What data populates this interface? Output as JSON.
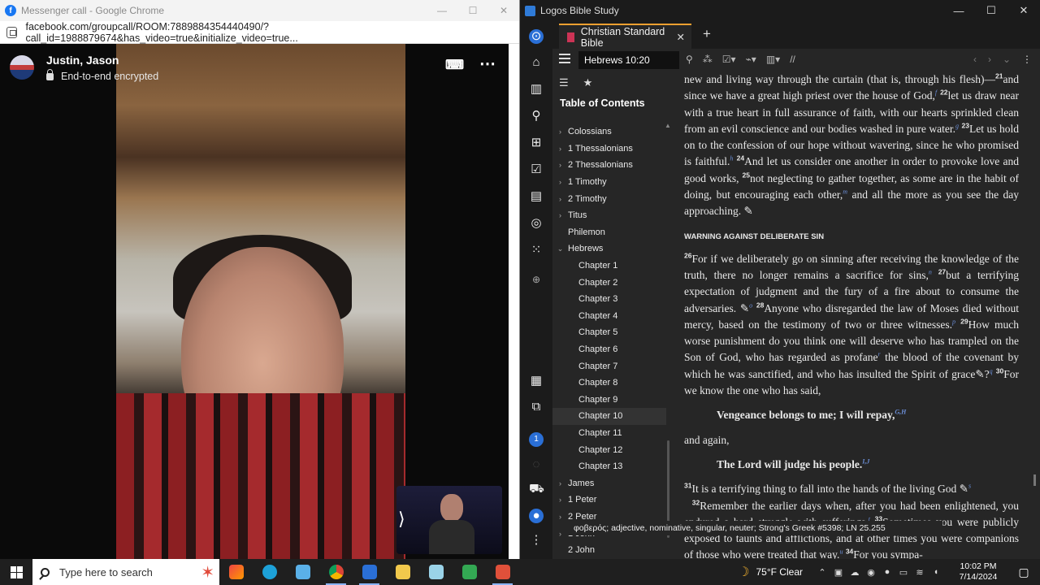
{
  "chrome": {
    "title": "Messenger call - Google Chrome",
    "url": "facebook.com/groupcall/ROOM:7889884354440490/?call_id=1988879674&has_video=true&initialize_video=true...",
    "minimize": "—",
    "maximize": "☐",
    "close": "✕"
  },
  "call": {
    "participant": "Justin, Jason",
    "encryption": "End-to-end encrypted",
    "more": "⋯"
  },
  "logos": {
    "title": "Logos Bible Study",
    "tab": "Christian Standard Bible",
    "reference": "Hebrews 10:20",
    "toc_title": "Table of Contents",
    "toc": [
      {
        "label": "Colossians",
        "type": "book",
        "arrow": "›"
      },
      {
        "label": "1 Thessalonians",
        "type": "book",
        "arrow": "›"
      },
      {
        "label": "2 Thessalonians",
        "type": "book",
        "arrow": "›"
      },
      {
        "label": "1 Timothy",
        "type": "book",
        "arrow": "›"
      },
      {
        "label": "2 Timothy",
        "type": "book",
        "arrow": "›"
      },
      {
        "label": "Titus",
        "type": "book",
        "arrow": "›"
      },
      {
        "label": "Philemon",
        "type": "book",
        "arrow": ""
      },
      {
        "label": "Hebrews",
        "type": "book",
        "arrow": "⌄"
      },
      {
        "label": "Chapter 1",
        "type": "chapter"
      },
      {
        "label": "Chapter 2",
        "type": "chapter"
      },
      {
        "label": "Chapter 3",
        "type": "chapter"
      },
      {
        "label": "Chapter 4",
        "type": "chapter"
      },
      {
        "label": "Chapter 5",
        "type": "chapter"
      },
      {
        "label": "Chapter 6",
        "type": "chapter"
      },
      {
        "label": "Chapter 7",
        "type": "chapter"
      },
      {
        "label": "Chapter 8",
        "type": "chapter"
      },
      {
        "label": "Chapter 9",
        "type": "chapter"
      },
      {
        "label": "Chapter 10",
        "type": "chapter",
        "selected": true
      },
      {
        "label": "Chapter 11",
        "type": "chapter"
      },
      {
        "label": "Chapter 12",
        "type": "chapter"
      },
      {
        "label": "Chapter 13",
        "type": "chapter"
      },
      {
        "label": "James",
        "type": "book",
        "arrow": "›"
      },
      {
        "label": "1 Peter",
        "type": "book",
        "arrow": "›"
      },
      {
        "label": "2 Peter",
        "type": "book",
        "arrow": "›"
      },
      {
        "label": "1 John",
        "type": "book",
        "arrow": "›"
      },
      {
        "label": "2 John",
        "type": "book",
        "arrow": ""
      }
    ],
    "text": {
      "p1": "new and living way through the curtain (that is, through his flesh)—",
      "v21n": "21",
      "v21": "and since we have a great high priest over the house of God,",
      "v22n": "22",
      "v22": "let us draw near with a true heart in full assurance of faith, with our hearts sprinkled clean from an evil conscience and our bodies washed in pure water.",
      "v23n": "23",
      "v23": "Let us hold on to the confession of our hope without wavering, since he who promised is faithful.",
      "v24n": "24",
      "v24": "And let us consider one another in order to provoke love and good works,",
      "v25n": "25",
      "v25": "not neglecting to gather together, as some are in the habit of doing, but encouraging each other,",
      "v25b": "and all the more as you see the day approaching.",
      "heading": "WARNING AGAINST DELIBERATE SIN",
      "v26n": "26",
      "v26": "For if we deliberately go on sinning after receiving the knowledge of the truth, there no longer remains a sacrifice for sins,",
      "v27n": "27",
      "v27": "but a terrifying expectation of judgment and the fury of a fire about to consume the adversaries.",
      "v28n": "28",
      "v28": "Anyone who disregarded the law of Moses died without mercy, based on the testimony of two or three witnesses.",
      "v29n": "29",
      "v29": "How much worse punishment do you think one will deserve who has trampled on the Son of God, who has regarded as profane",
      "v29b": "the blood of the covenant by which he was sanctified, and who has insulted the Spirit of grace",
      "v29c": "?",
      "v30n": "30",
      "v30": "For we know the one who has said,",
      "quote1": "Vengeance belongs to me; I will repay,",
      "and_again": "and again,",
      "quote2": "The Lord will judge his people.",
      "v31n": "31",
      "v31": "It is a terrifying thing to fall into the hands of the living God",
      "v32n": "32",
      "v32": "Remember the earlier days when, after you had been enlightened, you endured a hard struggle with sufferings.",
      "v33n": "33",
      "v33": "Sometimes you were publicly exposed to taunts and afflictions, and at other times you were companions of those who were treated that way.",
      "v34n": "34",
      "v34": "For you sympa-"
    },
    "fn": {
      "f": "f",
      "g": "g",
      "h": "h",
      "i": "i",
      "j": "j",
      "k": "k",
      "l": "l",
      "m": "m",
      "n": "n",
      "o": "o",
      "p": "p",
      "q": "q",
      "r": "r",
      "gh": "G,H",
      "ij": "I,J",
      "s": "s",
      "t": "t",
      "u": "u"
    },
    "tooltip": "φοβερός; adjective, nominative, singular, neuter; Strong's Greek #5398; LN 25.255",
    "rail_badge": "1"
  },
  "taskbar": {
    "search_placeholder": "Type here to search",
    "weather": "75°F  Clear",
    "time": "10:02 PM",
    "date": "7/14/2024"
  },
  "colors": {
    "accent": "#2a6fd6",
    "tab_highlight": "#f0a030",
    "footnote": "#6c8fd8"
  }
}
